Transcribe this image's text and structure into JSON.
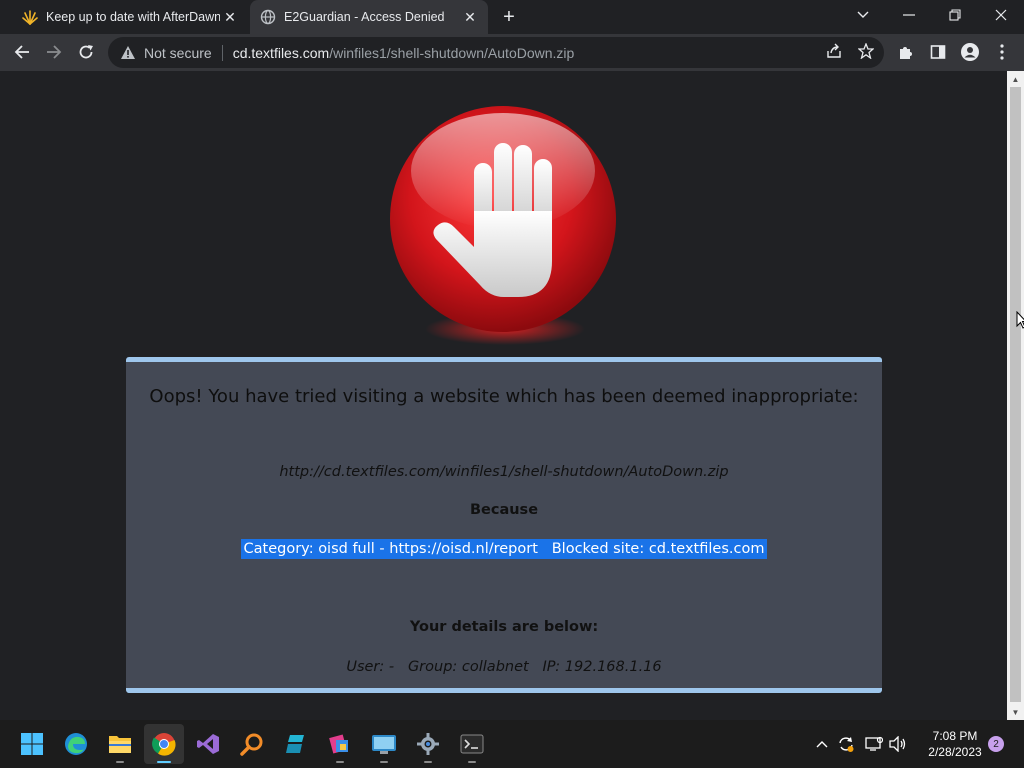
{
  "browser": {
    "tabs": [
      {
        "title": "Keep up to date with AfterDawn!",
        "icon": "afterdawn-favicon-icon",
        "active": false
      },
      {
        "title": "E2Guardian - Access Denied",
        "icon": "globe-icon",
        "active": true
      }
    ],
    "address": {
      "security_label": "Not secure",
      "host": "cd.textfiles.com",
      "path": "/winfiles1/shell-shutdown/AutoDown.zip"
    }
  },
  "page": {
    "heading": "Oops! You have tried visiting a website which has been deemed inappropriate:",
    "blocked_url": "http://cd.textfiles.com/winfiles1/shell-shutdown/AutoDown.zip",
    "because_label": "Because",
    "reason": "Category: oisd full - https://oisd.nl/report   Blocked site: cd.textfiles.com",
    "details_heading": "Your details are below:",
    "user_line": "User: -   Group: collabnet   IP: 192.168.1.16",
    "colors": {
      "stop_red": "#d3151b",
      "box_bg": "#444955",
      "box_border": "#9ec6ec",
      "highlight": "#1a73e8"
    }
  },
  "taskbar": {
    "apps": [
      "windows-start-icon",
      "edge-icon",
      "file-explorer-icon",
      "chrome-icon",
      "visual-studio-icon",
      "search-magnifier-icon",
      "app-icon",
      "paint-icon",
      "control-panel-icon",
      "settings-gear-icon",
      "terminal-icon"
    ],
    "time": "7:08 PM",
    "date": "2/28/2023",
    "notification_count": "2"
  }
}
